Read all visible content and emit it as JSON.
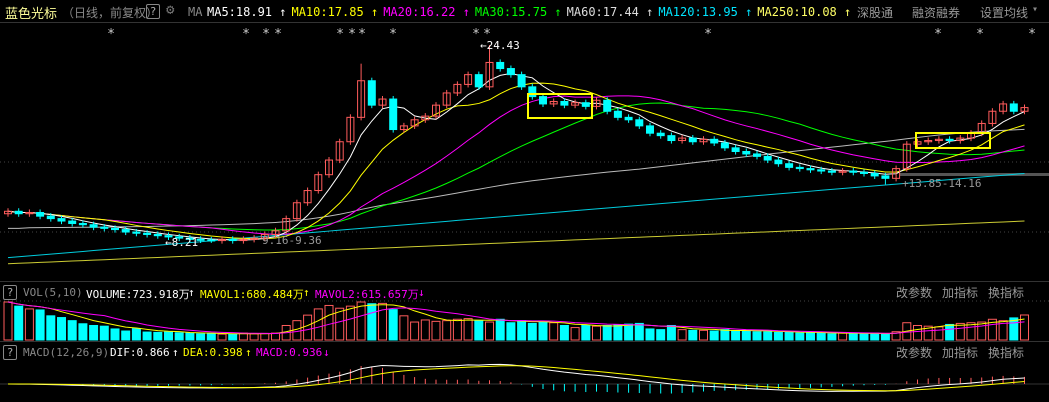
{
  "header": {
    "title": "蓝色光标",
    "subtitle": "（日线，前复权）",
    "help": "?",
    "ma_label": "MA",
    "ma": [
      {
        "text": "MA5:18.91",
        "arrow": "↑",
        "color": "#ffffff"
      },
      {
        "text": "MA10:17.85",
        "arrow": "↑",
        "color": "#ffff00"
      },
      {
        "text": "MA20:16.22",
        "arrow": "↑",
        "color": "#ff00ff"
      },
      {
        "text": "MA30:15.75",
        "arrow": "↑",
        "color": "#00ff00"
      },
      {
        "text": "MA60:17.44",
        "arrow": "↑",
        "color": "#dddddd"
      },
      {
        "text": "MA120:13.95",
        "arrow": "↑",
        "color": "#00e5ff"
      },
      {
        "text": "MA250:10.08",
        "arrow": "↑",
        "color": "#ffff66"
      }
    ],
    "buttons": [
      "深股通",
      "融资融券",
      "设置均线"
    ],
    "dropdown_icon": "▾"
  },
  "main_chart": {
    "annotations": {
      "high": "24.43",
      "low": "8.21",
      "range_left": "9.16-9.36",
      "range_right": "13.85-14.16"
    },
    "stars": "*",
    "opens": [
      10.6,
      10.8,
      10.6,
      10.7,
      10.4,
      10.2,
      10.0,
      9.8,
      9.7,
      9.5,
      9.4,
      9.3,
      9.1,
      9.0,
      8.9,
      8.8,
      8.7,
      8.6,
      8.5,
      8.45,
      8.4,
      8.5,
      8.4,
      8.5,
      8.6,
      8.9,
      9.2,
      10.2,
      11.5,
      12.5,
      13.8,
      15.0,
      16.5,
      18.5,
      21.5,
      19.5,
      20.0,
      17.5,
      17.8,
      18.3,
      18.6,
      19.5,
      20.5,
      21.2,
      22.0,
      21.0,
      23.0,
      22.5,
      22.0,
      21.0,
      20.2,
      19.6,
      19.8,
      19.5,
      19.7,
      19.4,
      19.9,
      19.0,
      18.5,
      18.3,
      17.8,
      17.2,
      17.0,
      16.6,
      16.8,
      16.5,
      16.7,
      16.4,
      16.0,
      15.7,
      15.5,
      15.3,
      15.0,
      14.7,
      14.4,
      14.3,
      14.2,
      14.1,
      14.0,
      14.1,
      14.0,
      13.9,
      13.7,
      13.5,
      14.3,
      16.3,
      16.5,
      16.6,
      16.7,
      16.6,
      16.8,
      17.2,
      18.0,
      19.0,
      19.6,
      19.0
    ],
    "closes": [
      10.8,
      10.6,
      10.7,
      10.4,
      10.2,
      10.0,
      9.8,
      9.7,
      9.5,
      9.4,
      9.3,
      9.1,
      9.0,
      8.9,
      8.8,
      8.7,
      8.6,
      8.5,
      8.45,
      8.4,
      8.5,
      8.4,
      8.5,
      8.6,
      8.9,
      9.2,
      10.2,
      11.5,
      12.5,
      13.8,
      15.0,
      16.5,
      18.5,
      21.5,
      19.5,
      20.0,
      17.5,
      17.8,
      18.3,
      18.6,
      19.5,
      20.5,
      21.2,
      22.0,
      21.0,
      23.0,
      22.5,
      22.0,
      21.0,
      20.2,
      19.6,
      19.8,
      19.5,
      19.7,
      19.4,
      19.9,
      19.0,
      18.5,
      18.3,
      17.8,
      17.2,
      17.0,
      16.6,
      16.8,
      16.5,
      16.7,
      16.4,
      16.0,
      15.7,
      15.5,
      15.3,
      15.0,
      14.7,
      14.4,
      14.3,
      14.2,
      14.1,
      14.0,
      14.1,
      14.0,
      13.9,
      13.7,
      13.5,
      14.3,
      16.3,
      16.5,
      16.6,
      16.7,
      16.6,
      16.8,
      17.2,
      18.0,
      19.0,
      19.6,
      19.0,
      19.3
    ],
    "volumes": [
      1100,
      980,
      900,
      870,
      700,
      650,
      560,
      470,
      420,
      400,
      320,
      260,
      330,
      230,
      220,
      230,
      210,
      200,
      180,
      180,
      170,
      170,
      200,
      180,
      190,
      200,
      420,
      560,
      720,
      900,
      1000,
      920,
      980,
      1100,
      1050,
      1060,
      880,
      700,
      520,
      580,
      540,
      560,
      600,
      620,
      560,
      520,
      600,
      500,
      560,
      480,
      520,
      500,
      420,
      360,
      420,
      400,
      420,
      440,
      460,
      480,
      320,
      300,
      420,
      300,
      280,
      280,
      260,
      300,
      260,
      280,
      240,
      240,
      220,
      240,
      200,
      220,
      200,
      180,
      200,
      190,
      180,
      200,
      160,
      240,
      500,
      420,
      400,
      380,
      450,
      480,
      500,
      520,
      600,
      560,
      640,
      723.918
    ]
  },
  "volume_panel": {
    "help": "?",
    "name": "VOL(5,10)",
    "volume": "VOLUME:723.918万",
    "volume_arrow": "↑",
    "mavol1": "MAVOL1:680.484万",
    "mavol1_arrow": "↑",
    "mavol2": "MAVOL2:615.657万",
    "mavol2_arrow": "↓",
    "buttons": [
      "改参数",
      "加指标",
      "换指标"
    ]
  },
  "macd_panel": {
    "help": "?",
    "name": "MACD(12,26,9)",
    "dif": "DIF:0.866",
    "dif_arrow": "↑",
    "dea": "DEA:0.398",
    "dea_arrow": "↑",
    "macd": "MACD:0.936",
    "macd_arrow": "↓",
    "buttons": [
      "改参数",
      "加指标",
      "换指标"
    ]
  },
  "colors": {
    "up": "#ff5c5c",
    "down": "#00ffff",
    "bg": "#000000"
  }
}
